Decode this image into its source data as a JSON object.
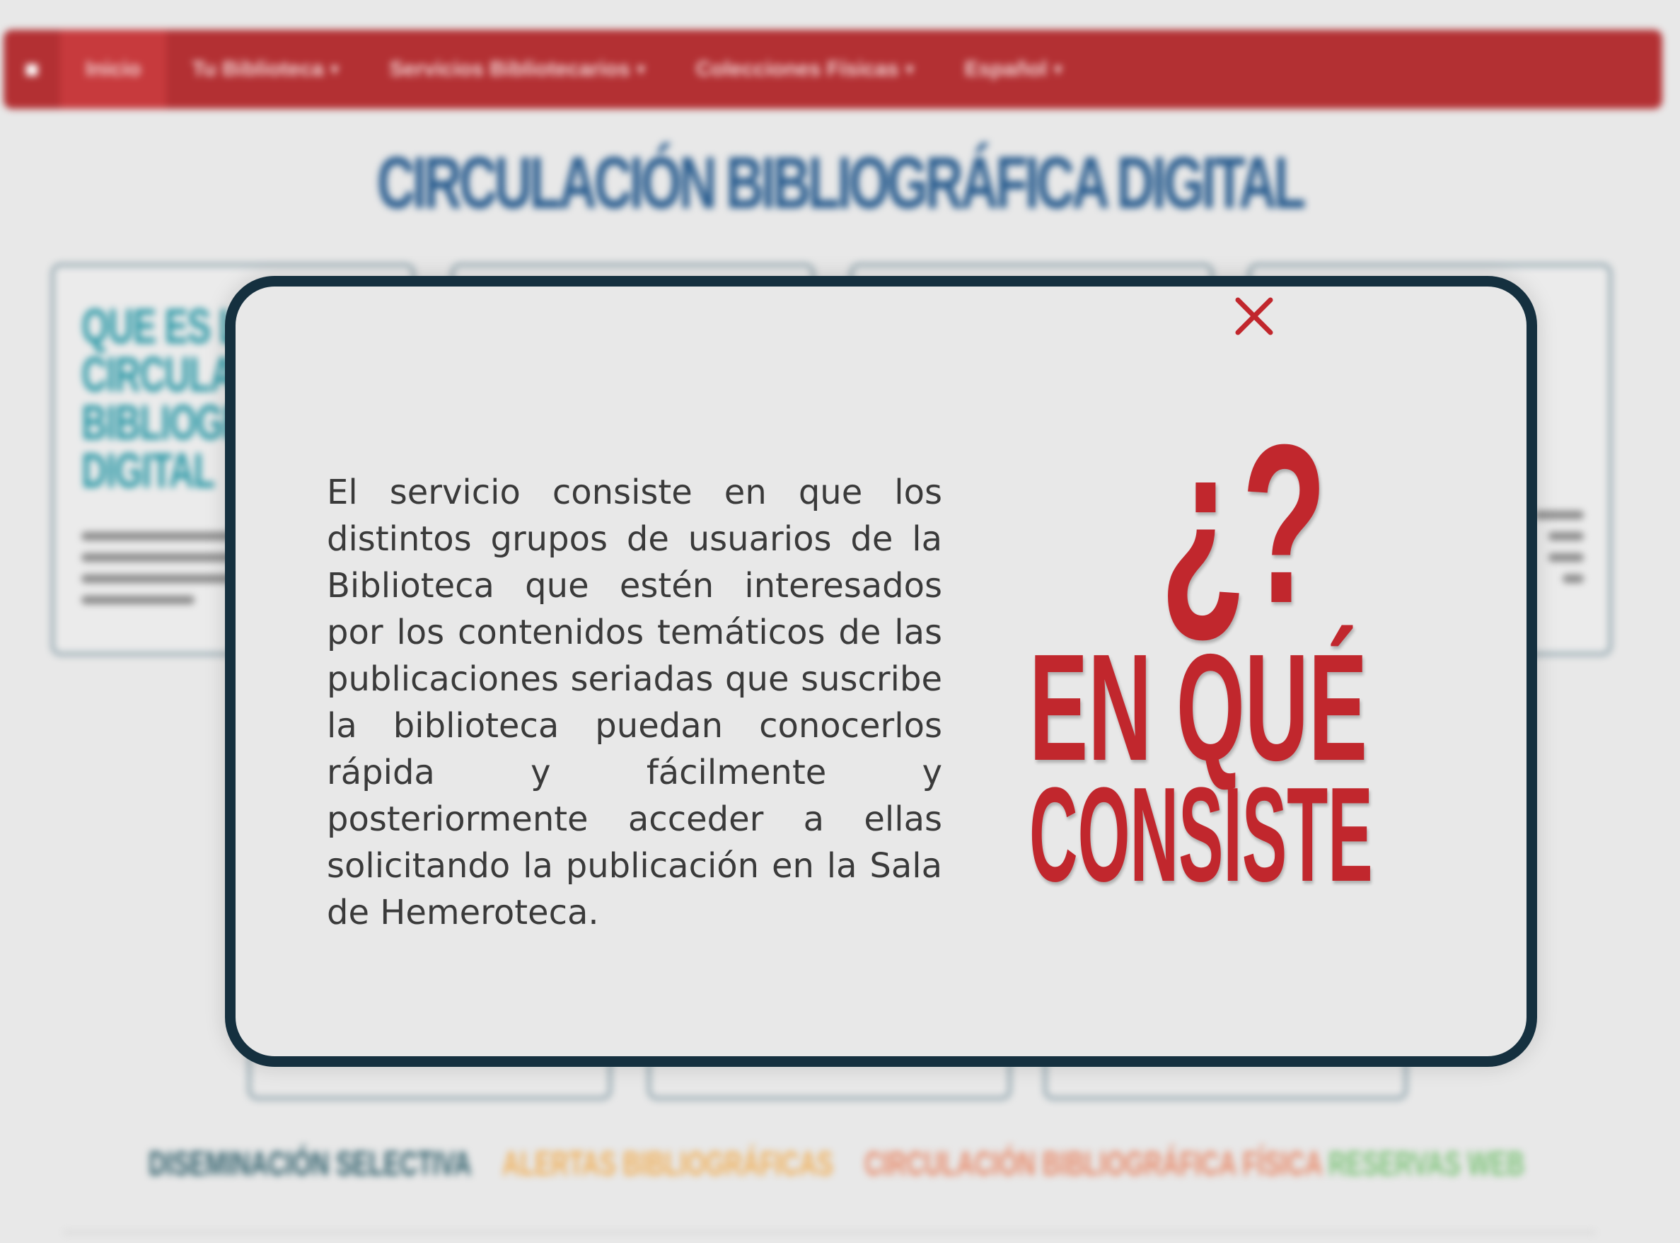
{
  "navbar": {
    "items": [
      {
        "label": "Inicio",
        "active": true
      },
      {
        "label": "Tu Biblioteca",
        "has_dropdown": true
      },
      {
        "label": "Servicios Bibliotecarios",
        "has_dropdown": true
      },
      {
        "label": "Colecciones Físicas",
        "has_dropdown": true
      },
      {
        "label": "Español",
        "has_dropdown": true
      }
    ]
  },
  "page": {
    "title": "CIRCULACIÓN BIBLIOGRÁFICA DIGITAL",
    "card_heading": "QUE ES LA CIRCULACIÓN BIBLIOGRÁFICA DIGITAL"
  },
  "bottom_links": [
    {
      "label": "DISEMINACIÓN SELECTIVA",
      "color": "#2f5f6b"
    },
    {
      "label": "ALERTAS BIBLIOGRÁFICAS",
      "color": "#f0b05a"
    },
    {
      "label": "CIRCULACIÓN BIBLIOGRÁFICA FÍSICA",
      "color": "#e88a6a"
    },
    {
      "label": "RESERVAS WEB",
      "color": "#7ec47a"
    }
  ],
  "modal": {
    "body": "El servicio consiste en que los distintos grupos de usuarios de la Biblioteca que estén interesados por los contenidos temáticos de las publicaciones seriadas que suscribe la biblioteca puedan conocerlos rápida y fácilmente y posteriormente acceder a ellas solicitando la publicación en la Sala de Hemeroteca.",
    "hero_symbol": "¿?",
    "hero_line1": "EN QUÉ",
    "hero_line2": "CONSISTE",
    "close_icon": "close-icon",
    "accent_color": "#c1272d",
    "border_color": "#15303f"
  }
}
